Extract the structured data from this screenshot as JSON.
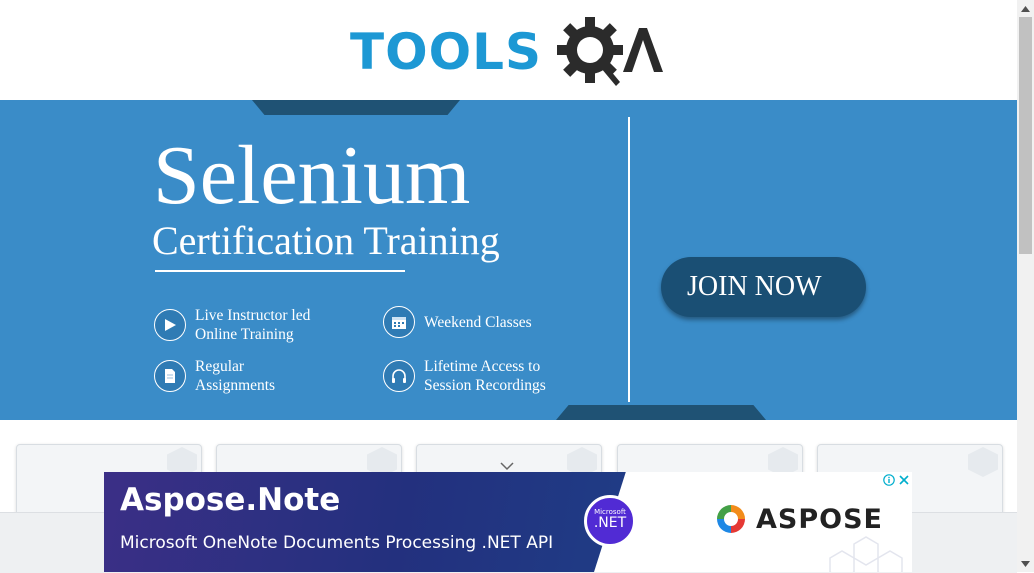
{
  "logo": {
    "text": "TOOLS",
    "suffix": "QA"
  },
  "banner": {
    "title": "Selenium",
    "subtitle": "Certification Training",
    "features": [
      {
        "label": "Live Instructor led\nOnline Training",
        "icon": "play-icon"
      },
      {
        "label": "Weekend Classes",
        "icon": "calendar-icon"
      },
      {
        "label": "Regular\nAssignments",
        "icon": "document-icon"
      },
      {
        "label": "Lifetime Access to\nSession Recordings",
        "icon": "headphones-icon"
      }
    ],
    "cta": "JOIN NOW"
  },
  "ad": {
    "title": "Aspose.Note",
    "subtitle": "Microsoft OneNote Documents Processing .NET API",
    "badge_small": "Microsoft",
    "badge_big": ".NET",
    "brand": "ASPOSE",
    "info": "i",
    "close": "✕"
  },
  "colors": {
    "accent": "#1d98d4",
    "banner": "#3a8cc8",
    "cta": "#1a4f74"
  }
}
